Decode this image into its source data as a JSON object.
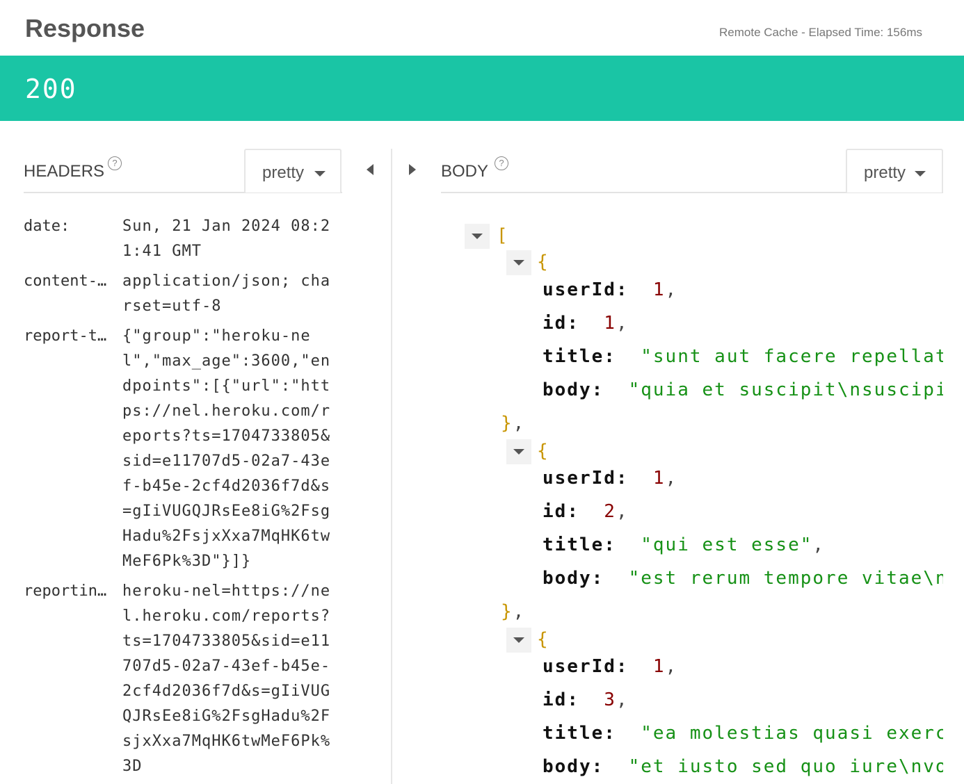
{
  "header": {
    "title": "Response",
    "meta": "Remote Cache -  Elapsed Time: 156ms"
  },
  "status": {
    "code": "200",
    "color": "#1ac5a5"
  },
  "headers_panel": {
    "title": "HEADERS",
    "help_icon": "?",
    "format_label": "pretty",
    "rows": [
      {
        "key": "date:",
        "value": "Sun, 21 Jan 2024 08:21:41 GMT"
      },
      {
        "key": "content-…",
        "value": "application/json; charset=utf-8"
      },
      {
        "key": "report-t…",
        "value": "{\"group\":\"heroku-nel\",\"max_age\":3600,\"endpoints\":[{\"url\":\"https://nel.heroku.com/reports?ts=1704733805&sid=e11707d5-02a7-43ef-b45e-2cf4d2036f7d&s=gIiVUGQJRsEe8iG%2FsgHadu%2FsjxXxa7MqHK6twMeF6Pk%3D\"}]}"
      },
      {
        "key": "reportin…",
        "value": "heroku-nel=https://nel.heroku.com/reports?ts=1704733805&sid=e11707d5-02a7-43ef-b45e-2cf4d2036f7d&s=gIiVUGQJRsEe8iG%2FsgHadu%2FsjxXxa7MqHK6twMeF6Pk%3D"
      }
    ]
  },
  "body_panel": {
    "title": "BODY",
    "help_icon": "?",
    "format_label": "pretty",
    "open_bracket": "[",
    "open_brace": "{",
    "close_brace": "}",
    "comma": ",",
    "colon": ":",
    "items": [
      {
        "userId_key": "userId",
        "userId": "1",
        "id_key": "id",
        "id": "1",
        "title_key": "title",
        "title": "\"sunt aut facere repellat provident",
        "body_key": "body",
        "body": "\"quia et suscipit\\nsuscipit recusandae"
      },
      {
        "userId_key": "userId",
        "userId": "1",
        "id_key": "id",
        "id": "2",
        "title_key": "title",
        "title": "\"qui est esse\"",
        "body_key": "body",
        "body": "\"est rerum tempore vitae\\nsequi sint"
      },
      {
        "userId_key": "userId",
        "userId": "1",
        "id_key": "id",
        "id": "3",
        "title_key": "title",
        "title": "\"ea molestias quasi exercitationem",
        "body_key": "body",
        "body": "\"et iusto sed quo iure\\nvoluptatem"
      }
    ]
  }
}
